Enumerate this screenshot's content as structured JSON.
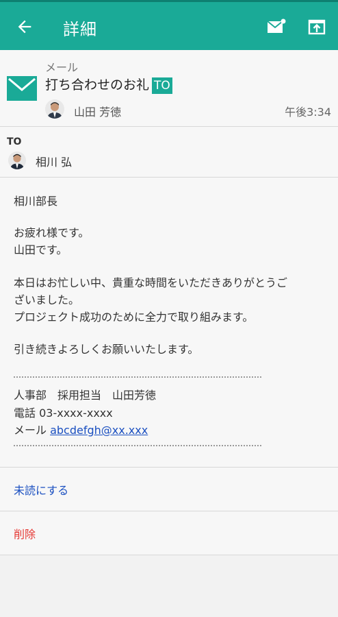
{
  "appbar": {
    "title": "詳細",
    "back_icon": "back-arrow-icon",
    "action_icons": [
      "mail-notify-icon",
      "upload-box-icon"
    ]
  },
  "message": {
    "kind": "メール",
    "subject": "打ち合わせのお礼",
    "subject_tag": "TO",
    "sender": "山田 芳徳",
    "time": "午後3:34"
  },
  "to": {
    "label": "TO",
    "recipient": "相川 弘"
  },
  "body": {
    "greeting": "相川部長",
    "line1": "お疲れ様です。",
    "line2": "山田です。",
    "line3": "本日はお忙しい中、貴重な時間をいただきありがとうご",
    "line4": "ざいました。",
    "line5": "プロジェクト成功のために全力で取り組みます。",
    "line6": "引き続きよろしくお願いいたします。",
    "sig_line1": "人事部　採用担当　山田芳徳",
    "sig_line2": "電話 03-xxxx-xxxx",
    "sig_mail_label": "メール ",
    "sig_mail": "abcdefgh@xx.xxx"
  },
  "actions": {
    "mark_unread": "未読にする",
    "delete": "削除"
  },
  "colors": {
    "accent": "#1aaa97",
    "link": "#1a4fc0",
    "danger": "#e53935"
  }
}
